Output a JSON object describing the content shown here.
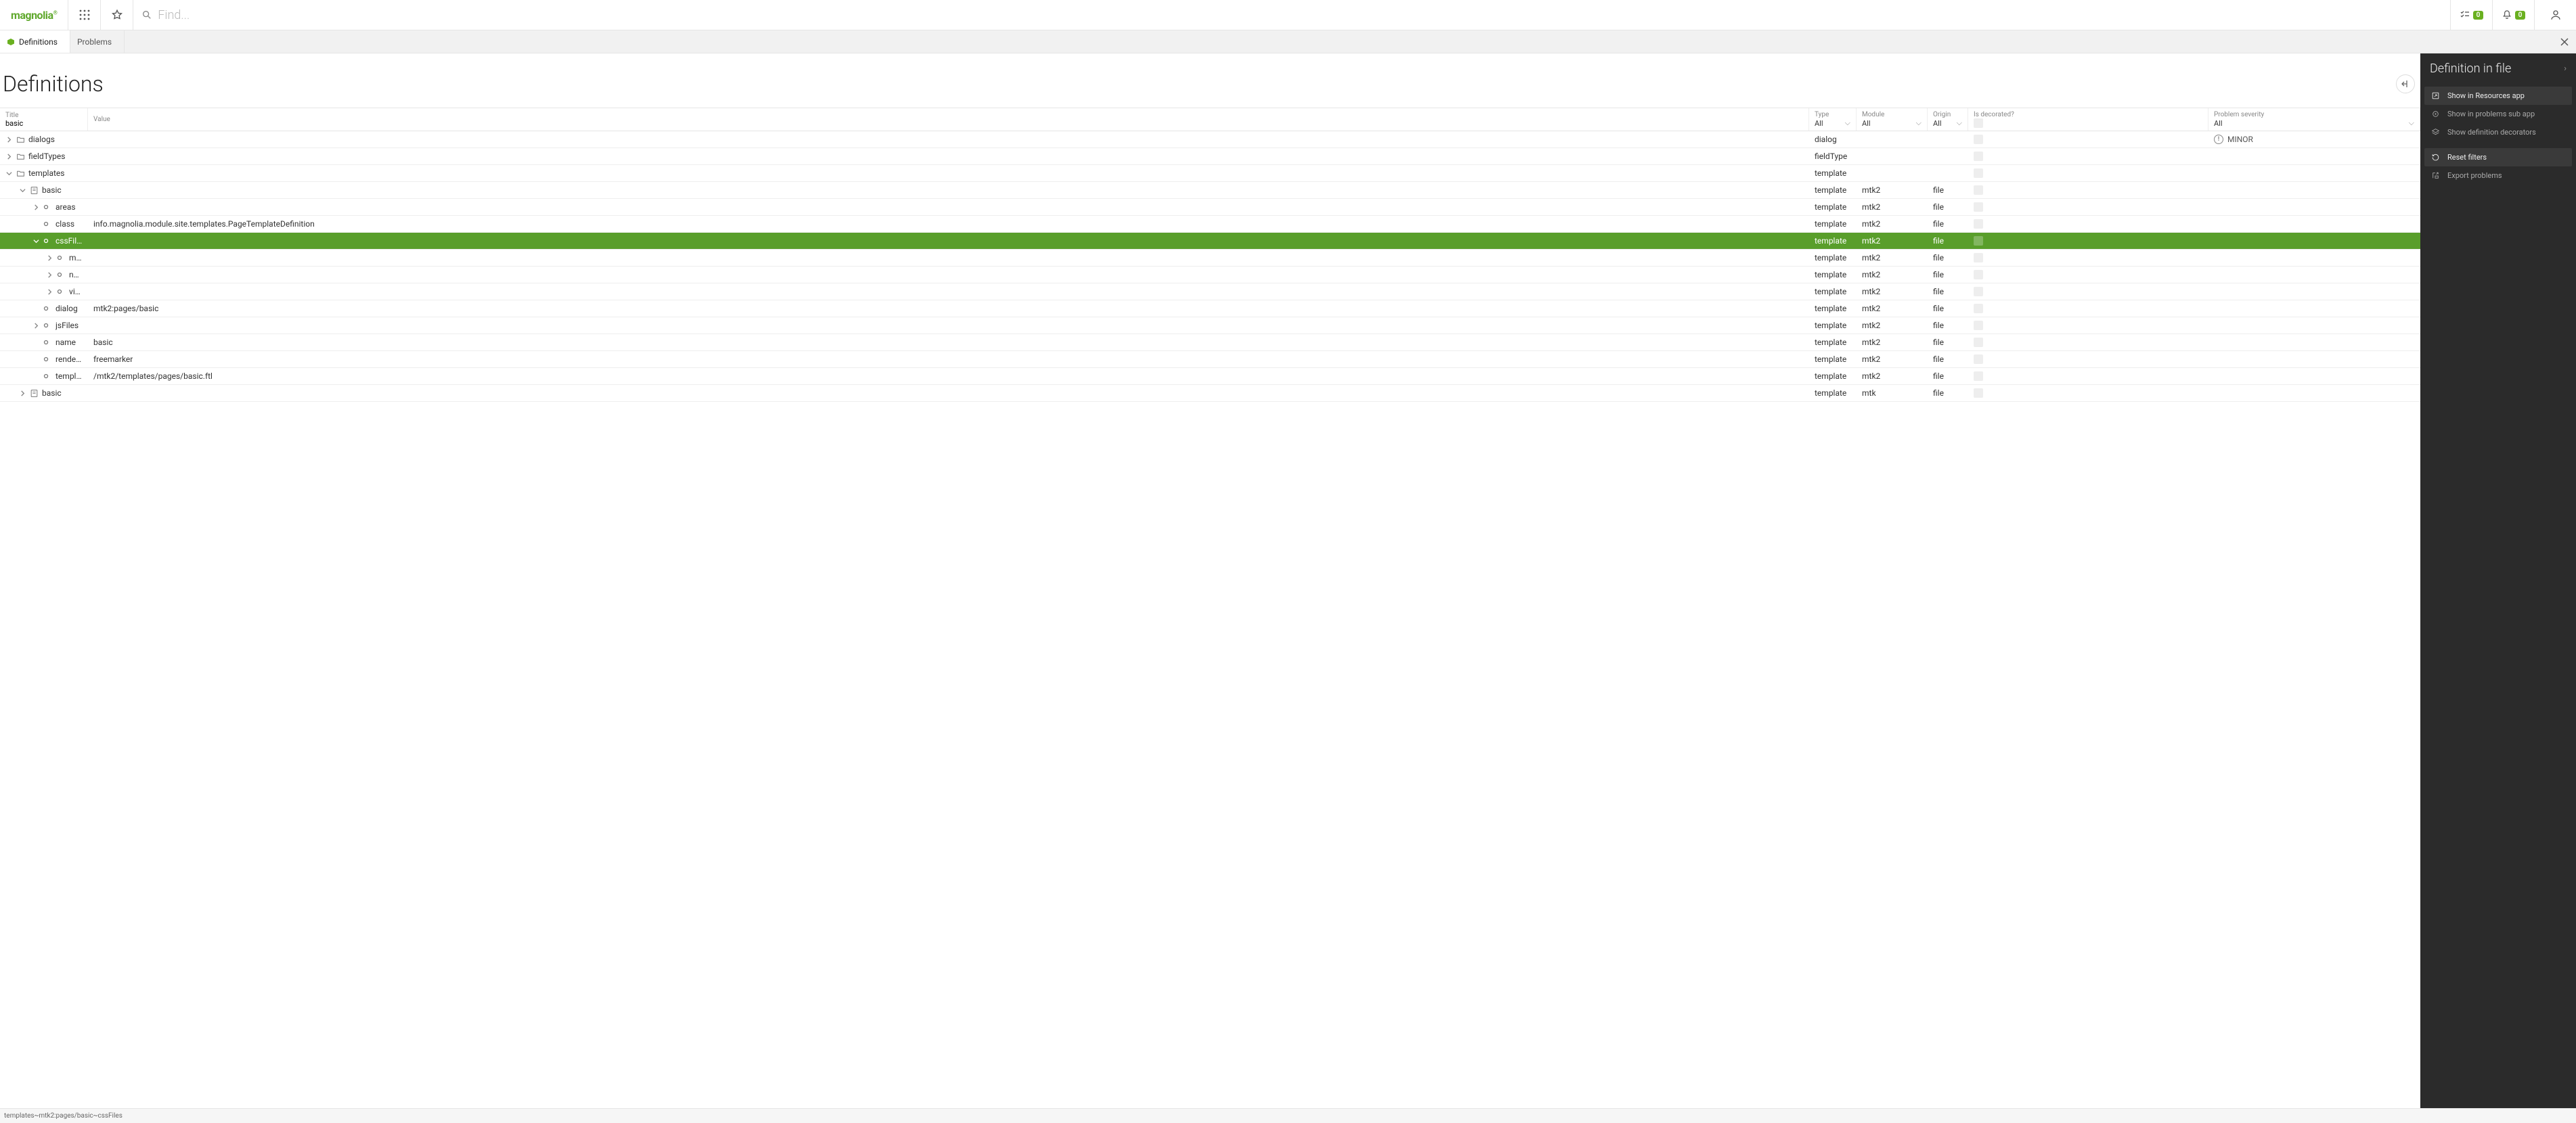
{
  "header": {
    "logo": "magnolia",
    "search_placeholder": "Find...",
    "tasks_count": "0",
    "notifications_count": "0"
  },
  "tabs": {
    "items": [
      {
        "label": "Definitions",
        "active": true,
        "icon": "definitions"
      },
      {
        "label": "Problems",
        "active": false,
        "icon": ""
      }
    ]
  },
  "page": {
    "title": "Definitions"
  },
  "columns": {
    "title": {
      "label": "Title",
      "filter": "basic"
    },
    "value": {
      "label": "Value",
      "filter": ""
    },
    "type": {
      "label": "Type",
      "filter": "All"
    },
    "module": {
      "label": "Module",
      "filter": "All"
    },
    "origin": {
      "label": "Origin",
      "filter": "All"
    },
    "decorated": {
      "label": "Is decorated?",
      "filter": ""
    },
    "severity": {
      "label": "Problem severity",
      "filter": "All"
    }
  },
  "rows": [
    {
      "depth": 0,
      "expander": "right",
      "icon": "folder",
      "title": "dialogs",
      "value": "",
      "type": "dialog",
      "module": "",
      "origin": "",
      "decor": true,
      "severity": "MINOR",
      "selected": false
    },
    {
      "depth": 0,
      "expander": "right",
      "icon": "folder",
      "title": "fieldTypes",
      "value": "",
      "type": "fieldType",
      "module": "",
      "origin": "",
      "decor": true,
      "severity": "",
      "selected": false
    },
    {
      "depth": 0,
      "expander": "down",
      "icon": "folder",
      "title": "templates",
      "value": "",
      "type": "template",
      "module": "",
      "origin": "",
      "decor": true,
      "severity": "",
      "selected": false
    },
    {
      "depth": 1,
      "expander": "down",
      "icon": "def",
      "title": "basic",
      "value": "",
      "type": "template",
      "module": "mtk2",
      "origin": "file",
      "decor": true,
      "severity": "",
      "selected": false
    },
    {
      "depth": 2,
      "expander": "right",
      "icon": "node",
      "title": "areas",
      "value": "",
      "type": "template",
      "module": "mtk2",
      "origin": "file",
      "decor": true,
      "severity": "",
      "selected": false
    },
    {
      "depth": 2,
      "expander": "",
      "icon": "node",
      "title": "class",
      "value": "info.magnolia.module.site.templates.PageTemplateDefinition",
      "type": "template",
      "module": "mtk2",
      "origin": "file",
      "decor": true,
      "severity": "",
      "selected": false
    },
    {
      "depth": 2,
      "expander": "down",
      "icon": "node",
      "title": "cssFiles",
      "value": "",
      "type": "template",
      "module": "mtk2",
      "origin": "file",
      "decor": true,
      "severity": "",
      "selected": true
    },
    {
      "depth": 3,
      "expander": "right",
      "icon": "node",
      "title": "main",
      "value": "",
      "type": "template",
      "module": "mtk2",
      "origin": "file",
      "decor": true,
      "severity": "",
      "selected": false
    },
    {
      "depth": 3,
      "expander": "right",
      "icon": "node",
      "title": "normalize",
      "value": "",
      "type": "template",
      "module": "mtk2",
      "origin": "file",
      "decor": true,
      "severity": "",
      "selected": false
    },
    {
      "depth": 3,
      "expander": "right",
      "icon": "node",
      "title": "video",
      "value": "",
      "type": "template",
      "module": "mtk2",
      "origin": "file",
      "decor": true,
      "severity": "",
      "selected": false
    },
    {
      "depth": 2,
      "expander": "",
      "icon": "node",
      "title": "dialog",
      "value": "mtk2:pages/basic",
      "type": "template",
      "module": "mtk2",
      "origin": "file",
      "decor": true,
      "severity": "",
      "selected": false
    },
    {
      "depth": 2,
      "expander": "right",
      "icon": "node",
      "title": "jsFiles",
      "value": "",
      "type": "template",
      "module": "mtk2",
      "origin": "file",
      "decor": true,
      "severity": "",
      "selected": false
    },
    {
      "depth": 2,
      "expander": "",
      "icon": "node",
      "title": "name",
      "value": "basic",
      "type": "template",
      "module": "mtk2",
      "origin": "file",
      "decor": true,
      "severity": "",
      "selected": false
    },
    {
      "depth": 2,
      "expander": "",
      "icon": "node",
      "title": "renderType",
      "value": "freemarker",
      "type": "template",
      "module": "mtk2",
      "origin": "file",
      "decor": true,
      "severity": "",
      "selected": false
    },
    {
      "depth": 2,
      "expander": "",
      "icon": "node",
      "title": "templateScript",
      "value": "/mtk2/templates/pages/basic.ftl",
      "type": "template",
      "module": "mtk2",
      "origin": "file",
      "decor": true,
      "severity": "",
      "selected": false
    },
    {
      "depth": 1,
      "expander": "right",
      "icon": "def",
      "title": "basic",
      "value": "",
      "type": "template",
      "module": "mtk",
      "origin": "file",
      "decor": true,
      "severity": "",
      "selected": false
    }
  ],
  "side_panel": {
    "title": "Definition in file",
    "actions": [
      {
        "label": "Show in Resources app",
        "enabled": true,
        "icon": "open"
      },
      {
        "label": "Show in problems sub app",
        "enabled": false,
        "icon": "target"
      },
      {
        "label": "Show definition decorators",
        "enabled": false,
        "icon": "layers"
      },
      {
        "sep": true
      },
      {
        "label": "Reset filters",
        "enabled": true,
        "icon": "reset"
      },
      {
        "label": "Export problems",
        "enabled": false,
        "icon": "export"
      }
    ]
  },
  "status": {
    "path": "templates~mtk2:pages/basic~cssFiles"
  }
}
